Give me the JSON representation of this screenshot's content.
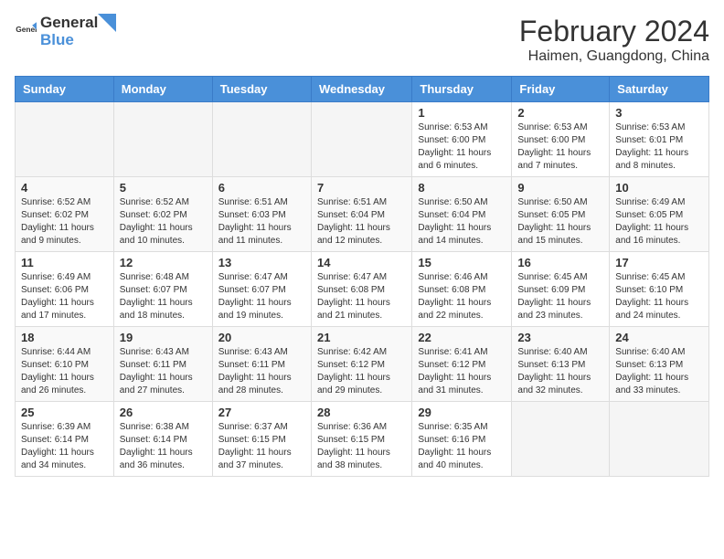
{
  "header": {
    "logo_general": "General",
    "logo_blue": "Blue",
    "title": "February 2024",
    "subtitle": "Haimen, Guangdong, China"
  },
  "days_of_week": [
    "Sunday",
    "Monday",
    "Tuesday",
    "Wednesday",
    "Thursday",
    "Friday",
    "Saturday"
  ],
  "weeks": [
    [
      {
        "day": "",
        "info": ""
      },
      {
        "day": "",
        "info": ""
      },
      {
        "day": "",
        "info": ""
      },
      {
        "day": "",
        "info": ""
      },
      {
        "day": "1",
        "info": "Sunrise: 6:53 AM\nSunset: 6:00 PM\nDaylight: 11 hours and 6 minutes."
      },
      {
        "day": "2",
        "info": "Sunrise: 6:53 AM\nSunset: 6:00 PM\nDaylight: 11 hours and 7 minutes."
      },
      {
        "day": "3",
        "info": "Sunrise: 6:53 AM\nSunset: 6:01 PM\nDaylight: 11 hours and 8 minutes."
      }
    ],
    [
      {
        "day": "4",
        "info": "Sunrise: 6:52 AM\nSunset: 6:02 PM\nDaylight: 11 hours and 9 minutes."
      },
      {
        "day": "5",
        "info": "Sunrise: 6:52 AM\nSunset: 6:02 PM\nDaylight: 11 hours and 10 minutes."
      },
      {
        "day": "6",
        "info": "Sunrise: 6:51 AM\nSunset: 6:03 PM\nDaylight: 11 hours and 11 minutes."
      },
      {
        "day": "7",
        "info": "Sunrise: 6:51 AM\nSunset: 6:04 PM\nDaylight: 11 hours and 12 minutes."
      },
      {
        "day": "8",
        "info": "Sunrise: 6:50 AM\nSunset: 6:04 PM\nDaylight: 11 hours and 14 minutes."
      },
      {
        "day": "9",
        "info": "Sunrise: 6:50 AM\nSunset: 6:05 PM\nDaylight: 11 hours and 15 minutes."
      },
      {
        "day": "10",
        "info": "Sunrise: 6:49 AM\nSunset: 6:05 PM\nDaylight: 11 hours and 16 minutes."
      }
    ],
    [
      {
        "day": "11",
        "info": "Sunrise: 6:49 AM\nSunset: 6:06 PM\nDaylight: 11 hours and 17 minutes."
      },
      {
        "day": "12",
        "info": "Sunrise: 6:48 AM\nSunset: 6:07 PM\nDaylight: 11 hours and 18 minutes."
      },
      {
        "day": "13",
        "info": "Sunrise: 6:47 AM\nSunset: 6:07 PM\nDaylight: 11 hours and 19 minutes."
      },
      {
        "day": "14",
        "info": "Sunrise: 6:47 AM\nSunset: 6:08 PM\nDaylight: 11 hours and 21 minutes."
      },
      {
        "day": "15",
        "info": "Sunrise: 6:46 AM\nSunset: 6:08 PM\nDaylight: 11 hours and 22 minutes."
      },
      {
        "day": "16",
        "info": "Sunrise: 6:45 AM\nSunset: 6:09 PM\nDaylight: 11 hours and 23 minutes."
      },
      {
        "day": "17",
        "info": "Sunrise: 6:45 AM\nSunset: 6:10 PM\nDaylight: 11 hours and 24 minutes."
      }
    ],
    [
      {
        "day": "18",
        "info": "Sunrise: 6:44 AM\nSunset: 6:10 PM\nDaylight: 11 hours and 26 minutes."
      },
      {
        "day": "19",
        "info": "Sunrise: 6:43 AM\nSunset: 6:11 PM\nDaylight: 11 hours and 27 minutes."
      },
      {
        "day": "20",
        "info": "Sunrise: 6:43 AM\nSunset: 6:11 PM\nDaylight: 11 hours and 28 minutes."
      },
      {
        "day": "21",
        "info": "Sunrise: 6:42 AM\nSunset: 6:12 PM\nDaylight: 11 hours and 29 minutes."
      },
      {
        "day": "22",
        "info": "Sunrise: 6:41 AM\nSunset: 6:12 PM\nDaylight: 11 hours and 31 minutes."
      },
      {
        "day": "23",
        "info": "Sunrise: 6:40 AM\nSunset: 6:13 PM\nDaylight: 11 hours and 32 minutes."
      },
      {
        "day": "24",
        "info": "Sunrise: 6:40 AM\nSunset: 6:13 PM\nDaylight: 11 hours and 33 minutes."
      }
    ],
    [
      {
        "day": "25",
        "info": "Sunrise: 6:39 AM\nSunset: 6:14 PM\nDaylight: 11 hours and 34 minutes."
      },
      {
        "day": "26",
        "info": "Sunrise: 6:38 AM\nSunset: 6:14 PM\nDaylight: 11 hours and 36 minutes."
      },
      {
        "day": "27",
        "info": "Sunrise: 6:37 AM\nSunset: 6:15 PM\nDaylight: 11 hours and 37 minutes."
      },
      {
        "day": "28",
        "info": "Sunrise: 6:36 AM\nSunset: 6:15 PM\nDaylight: 11 hours and 38 minutes."
      },
      {
        "day": "29",
        "info": "Sunrise: 6:35 AM\nSunset: 6:16 PM\nDaylight: 11 hours and 40 minutes."
      },
      {
        "day": "",
        "info": ""
      },
      {
        "day": "",
        "info": ""
      }
    ]
  ]
}
